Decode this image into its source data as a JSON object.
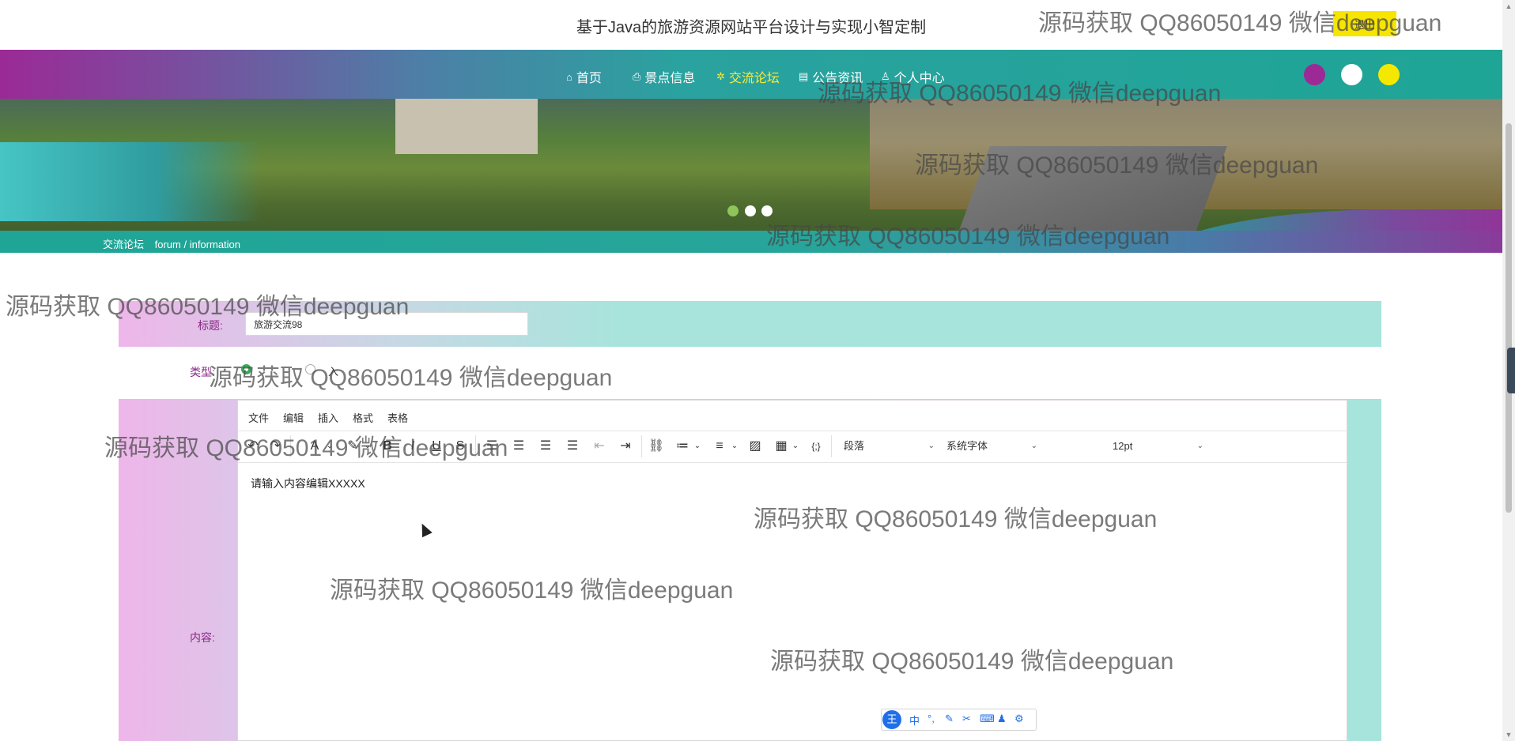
{
  "header": {
    "site_title": "基于Java的旅游资源网站平台设计与实现小智定制",
    "logout_label": "退出"
  },
  "nav": {
    "items": [
      {
        "label": "首页",
        "icon": "home-icon"
      },
      {
        "label": "景点信息",
        "icon": "printer-icon"
      },
      {
        "label": "交流论坛",
        "icon": "forum-icon",
        "active": true
      },
      {
        "label": "公告资讯",
        "icon": "document-icon"
      },
      {
        "label": "个人中心",
        "icon": "user-icon"
      }
    ],
    "theme_colors": [
      "#9b2a96",
      "#ffffff",
      "#f5e800"
    ]
  },
  "breadcrumb": {
    "title": "交流论坛",
    "subtitle": "forum / information"
  },
  "form": {
    "title_label": "标题:",
    "title_value": "旅游交流98",
    "type_label": "类型:",
    "type_option": "入",
    "content_label": "内容:"
  },
  "editor": {
    "menu": [
      "文件",
      "编辑",
      "插入",
      "格式",
      "表格"
    ],
    "paragraph_select": "段落",
    "font_select": "系统字体",
    "size_select": "12pt",
    "content": "请输入内容编辑XXXXX"
  },
  "ime": {
    "logo": "王",
    "mode": "中"
  },
  "watermark_text": "源码获取 QQ86050149 微信deepguan",
  "colors": {
    "accent_teal": "#1ea596",
    "accent_purple": "#9b2a96",
    "active_nav": "#f8ec3a",
    "logout_bg": "#f7e400",
    "label_color": "#8a2a86"
  }
}
